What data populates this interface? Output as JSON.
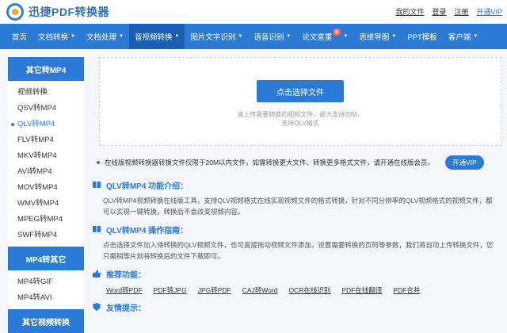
{
  "brand": {
    "name": "迅捷PDF转换器",
    "accent": "#2b7bd6"
  },
  "toplinks": [
    "我的文件",
    "登录",
    "注册",
    "开通VIP"
  ],
  "nav": [
    {
      "label": "首页",
      "caret": false
    },
    {
      "label": "文档转换",
      "caret": true
    },
    {
      "label": "文档处理",
      "caret": true
    },
    {
      "label": "音视频转换",
      "caret": true,
      "active": true
    },
    {
      "label": "图片文字识别",
      "caret": true
    },
    {
      "label": "语音识别",
      "caret": true
    },
    {
      "label": "论文查重",
      "caret": true,
      "badge": "新"
    },
    {
      "label": "思维导图",
      "caret": true
    },
    {
      "label": "PPT模板",
      "caret": false
    },
    {
      "label": "客户端",
      "caret": true
    }
  ],
  "sidebar": {
    "group1": {
      "title": "其它转MP4",
      "items": [
        "视频转换",
        "QSV转MP4",
        "QLV转MP4",
        "FLV转MP4",
        "MKV转MP4",
        "AVI转MP4",
        "MOV转MP4",
        "WMV转MP4",
        "MPEG转MP4",
        "SWF转MP4"
      ],
      "current": 2
    },
    "group2": {
      "title": "MP4转其它",
      "items": [
        "MP4转GIF",
        "MP4转AVI"
      ]
    },
    "group3": {
      "title": "其它视频转换"
    }
  },
  "upload": {
    "button": "点击选择文件",
    "hint1": "请上传需要转换的视频文件，最大支持20M，",
    "hint2": "支持QLV格式"
  },
  "notice": {
    "text": "在线版视频转换器转换文件仅限于20M以内文件，如需转换更大文件、转换更多格式文件，请开通在线版会员。",
    "button": "开通VIP"
  },
  "intro": {
    "title": "QLV转MP4 功能介绍：",
    "text": "QLV转MP4视频转换在线版工具，支持QLV视频格式在线实现视频文件的格式转换，针对不同分辨率的QLV视频格式的视频文件，都可以实现一键转换，转换后不会改变视频内容。"
  },
  "guide": {
    "title": "QLV转MP4 操作指南：",
    "text": "点击选择文件加入待转换的QLV视频文件，也可直接拖动视频文件添加，设置需要转换的页码等参数，我们将自动上传转换文件，您只需稍等片刻将转换后的文件下载即可。"
  },
  "recommend": {
    "title": "推荐功能：",
    "links": [
      "Word转PDF",
      "PDF转JPG",
      "JPG转PDF",
      "CAJ转Word",
      "OCR在线识别",
      "PDF在线翻译",
      "PDF合并"
    ]
  },
  "tips": {
    "title": "友情提示："
  }
}
